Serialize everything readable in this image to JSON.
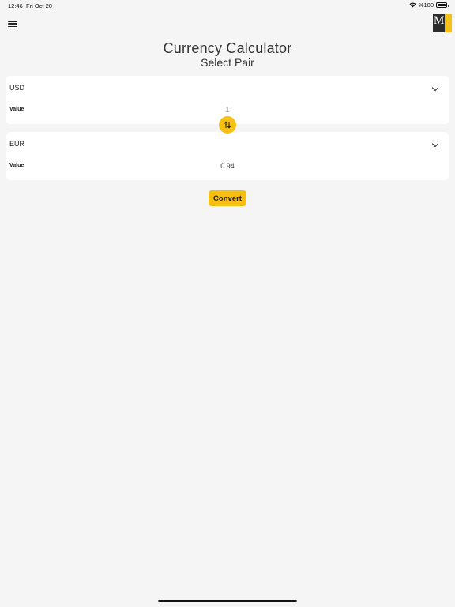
{
  "status_bar": {
    "time": "12:46",
    "date": "Fri Oct 20",
    "battery": "%100",
    "icons": [
      "wifi-icon",
      "battery-icon"
    ]
  },
  "header": {
    "menu_icon": "hamburger-menu-icon",
    "logo_letters": "M",
    "colors": {
      "logo_dark": "#2b2b2b",
      "logo_accent": "#f3c118"
    }
  },
  "main": {
    "title": "Currency Calculator",
    "subtitle": "Select Pair",
    "from": {
      "currency": "USD",
      "value_label": "Value",
      "value": "1"
    },
    "to": {
      "currency": "EUR",
      "value_label": "Value",
      "value": "0.94"
    },
    "swap_icon": "swap-arrows-icon",
    "convert_label": "Convert"
  },
  "colors": {
    "accent": "#f5c013",
    "background": "#f5f5f5",
    "card": "#ffffff"
  }
}
